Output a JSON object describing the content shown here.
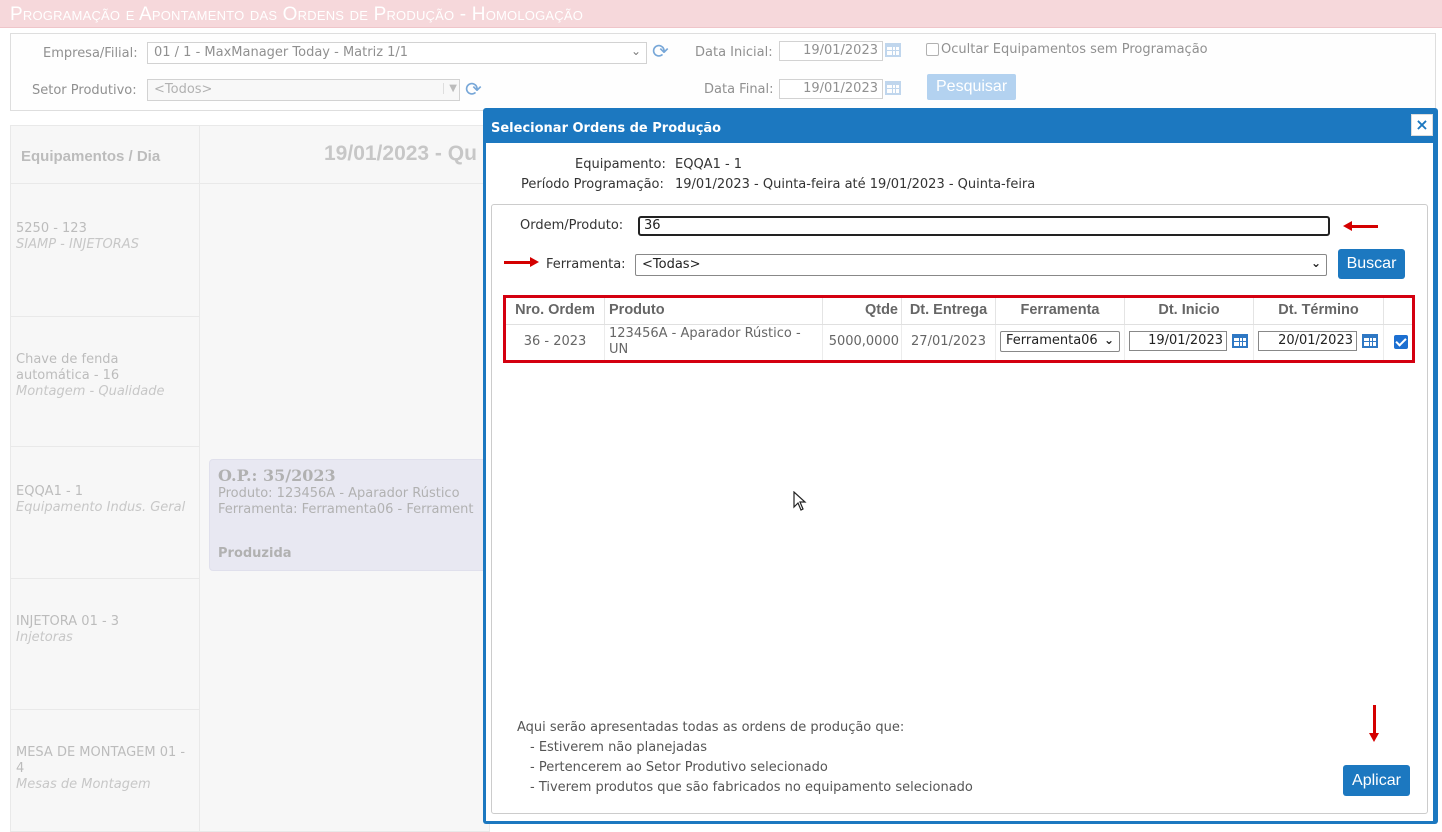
{
  "app": {
    "title": "Programação e Apontamento das Ordens de Produção  - Homologação"
  },
  "filters": {
    "empresa_label": "Empresa/Filial:",
    "empresa_value": "01 / 1 - MaxManager Today - Matriz 1/1",
    "setor_label": "Setor Produtivo:",
    "setor_value": "<Todos>",
    "data_inicial_label": "Data Inicial:",
    "data_inicial_value": "19/01/2023",
    "data_final_label": "Data Final:",
    "data_final_value": "19/01/2023",
    "ocultar_label": "Ocultar Equipamentos sem Programação",
    "ocultar_checked": false,
    "pesquisar_label": "Pesquisar"
  },
  "grid": {
    "header_equip": "Equipamentos / Dia",
    "header_day": "19/01/2023 - Qu",
    "equipments": [
      {
        "name": "5250 - 123",
        "type": "SIAMP - INJETORAS"
      },
      {
        "name": "Chave de fenda automática - 16",
        "type": "Montagem - Qualidade"
      },
      {
        "name": "EQQA1 - 1",
        "type": "Equipamento Indus. Geral"
      },
      {
        "name": "INJETORA 01 - 3",
        "type": "Injetoras"
      },
      {
        "name": "MESA DE MONTAGEM 01 - 4",
        "type": "Mesas de Montagem"
      }
    ],
    "op_card": {
      "title": "O.P.: 35/2023",
      "produto": "Produto: 123456A - Aparador Rústico",
      "ferramenta": "Ferramenta: Ferramenta06 - Ferrament",
      "status": "Produzida"
    }
  },
  "modal": {
    "title": "Selecionar Ordens de Produção",
    "close_label": "×",
    "equipamento_label": "Equipamento:",
    "equipamento_value": "EQQA1 - 1",
    "periodo_label": "Período Programação:",
    "periodo_value": "19/01/2023 - Quinta-feira até 19/01/2023 - Quinta-feira",
    "ordem_label": "Ordem/Produto:",
    "ordem_value": "36",
    "ferramenta_label": "Ferramenta:",
    "ferramenta_value": "<Todas>",
    "buscar_label": "Buscar",
    "table": {
      "headers": [
        "Nro. Ordem",
        "Produto",
        "Qtde",
        "Dt. Entrega",
        "Ferramenta",
        "Dt. Inicio",
        "Dt. Término"
      ],
      "rows": [
        {
          "nro_ordem": "36 - 2023",
          "produto_line1": "123456A - Aparador Rústico -",
          "produto_line2": "UN",
          "qtde": "5000,0000",
          "dt_entrega": "27/01/2023",
          "ferramenta": "Ferramenta06",
          "dt_inicio": "19/01/2023",
          "dt_termino": "20/01/2023",
          "selected": true
        }
      ]
    },
    "notes": {
      "intro": "Aqui serão apresentadas todas as ordens de produção que:",
      "items": [
        "- Estiverem não planejadas",
        "- Pertencerem ao Setor Produtivo selecionado",
        "- Tiverem produtos que são fabricados no equipamento selecionado"
      ]
    },
    "aplicar_label": "Aplicar"
  },
  "colors": {
    "accent": "#1c78c0",
    "title_bar": "#f2c4c8",
    "annotation_red": "#d40010"
  },
  "icons": {
    "refresh": "refresh-icon",
    "calendar": "calendar-icon",
    "close": "close-icon",
    "chevron": "chevron-down-icon"
  }
}
